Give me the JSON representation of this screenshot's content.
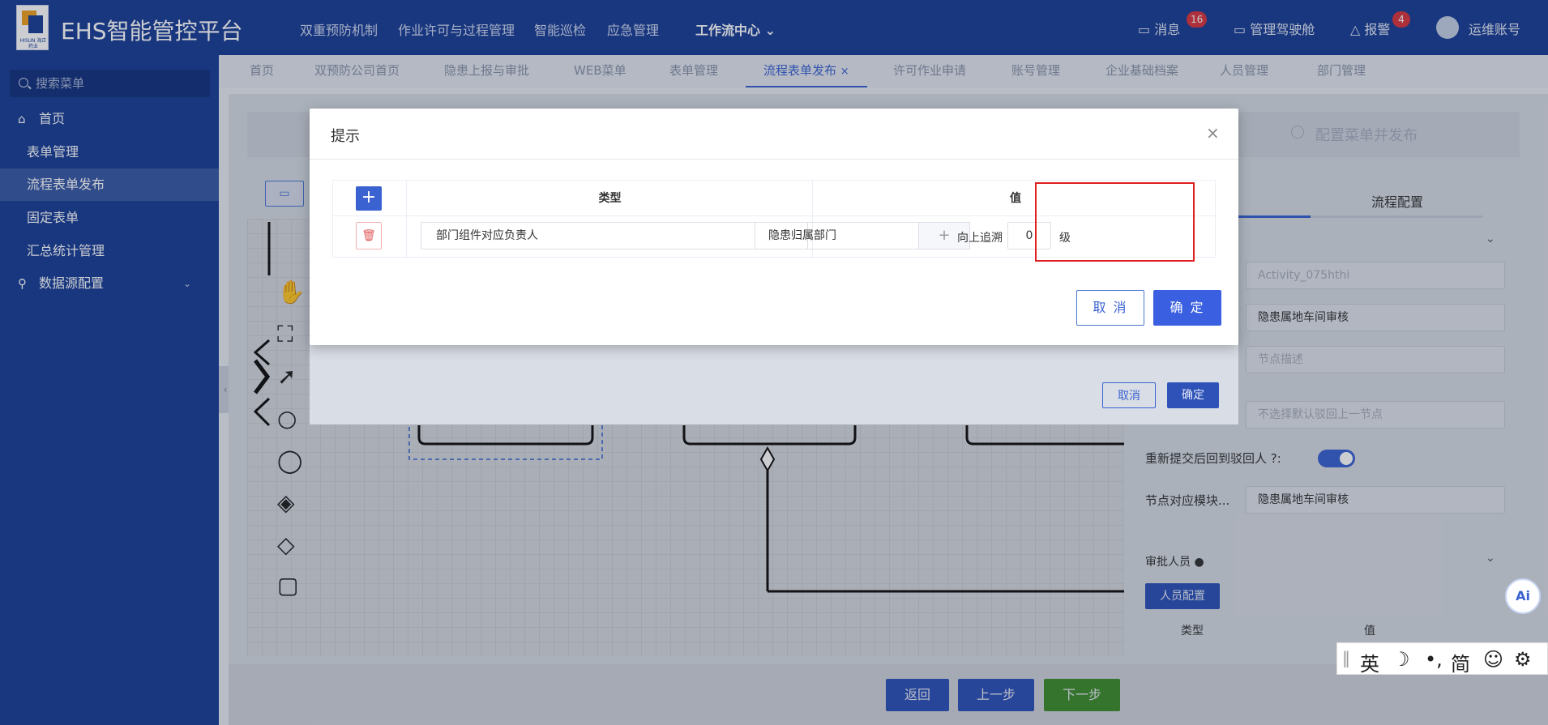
{
  "app": {
    "title": "EHS智能管控平台",
    "logo_text": "HISUN 海正药业"
  },
  "topnav": {
    "items": [
      "双重预防机制",
      "作业许可与过程管理",
      "智能巡检",
      "应急管理"
    ],
    "workflow": "工作流中心"
  },
  "top_right": {
    "messages": "消息",
    "messages_count": "16",
    "cockpit": "管理驾驶舱",
    "alarm": "报警",
    "alarm_count": "4",
    "account": "运维账号"
  },
  "sidebar": {
    "search_placeholder": "搜索菜单",
    "home": "首页",
    "items": [
      "表单管理",
      "流程表单发布",
      "固定表单",
      "汇总统计管理"
    ],
    "datasource": "数据源配置"
  },
  "tabs": [
    "首页",
    "双预防公司首页",
    "隐患上报与审批",
    "WEB菜单",
    "表单管理",
    "流程表单发布",
    "许可作业申请",
    "账号管理",
    "企业基础档案",
    "人员管理",
    "部门管理"
  ],
  "tabs_active_close": "×",
  "steps": {
    "publish": "配置菜单并发布"
  },
  "right_panel": {
    "tab_flow": "流程配置",
    "activity_id": "Activity_075hthi",
    "node_name": "隐患属地车间审核",
    "node_desc_placeholder": "节点描述",
    "reject_placeholder": "不选择默认驳回上一节点",
    "resubmit_label": "重新提交后回到驳回人",
    "module_label": "节点对应模块...",
    "module_value": "隐患属地车间审核",
    "approvers": "审批人员",
    "person_config": "人员配置",
    "table_type": "类型",
    "table_value": "值"
  },
  "bg_dialog": {
    "cancel": "取消",
    "ok": "确定"
  },
  "bottom": {
    "back": "返回",
    "prev": "上一步",
    "next": "下一步"
  },
  "modal": {
    "title": "提示",
    "close": "×",
    "col_type": "类型",
    "col_value": "值",
    "add": "+",
    "row": {
      "type": "部门组件对应负责人",
      "value": "隐患归属部门",
      "plus": "+",
      "trace_label": "向上追溯",
      "level": "0",
      "level_unit": "级"
    },
    "cancel": "取 消",
    "ok": "确 定"
  },
  "ime": {
    "items": [
      "英",
      "☽",
      "•,",
      "简",
      "☺",
      "⚙"
    ]
  },
  "ai": "Ai"
}
